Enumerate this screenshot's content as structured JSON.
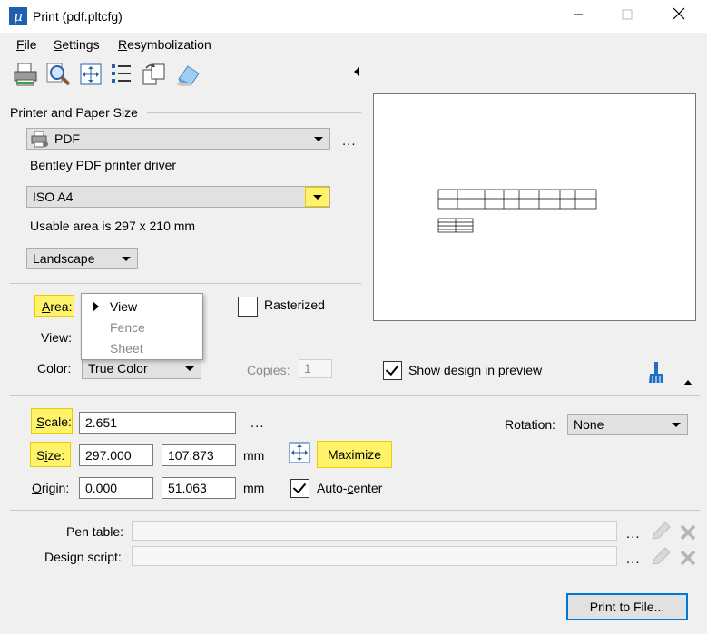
{
  "window": {
    "title": "Print  (pdf.pltcfg)",
    "app_icon_glyph": "µ"
  },
  "menu": {
    "file": {
      "pre": "",
      "u": "F",
      "post": "ile"
    },
    "settings": {
      "pre": "",
      "u": "S",
      "post": "ettings"
    },
    "resymbolization": {
      "pre": "",
      "u": "R",
      "post": "esymbolization"
    }
  },
  "printer": {
    "section_label": "Printer and Paper Size",
    "printer_name": "PDF",
    "driver": "Bentley PDF printer driver",
    "paper_size": "ISO A4",
    "usable_area": "Usable area is 297 x 210 mm",
    "orientation": "Landscape",
    "more": "..."
  },
  "area": {
    "label_pre": "",
    "label_u": "A",
    "label_post": "rea:",
    "menu_items": [
      {
        "label": "View",
        "selected": true,
        "enabled": true
      },
      {
        "label": "Fence",
        "selected": false,
        "enabled": false
      },
      {
        "label": "Sheet",
        "selected": false,
        "enabled": false
      }
    ]
  },
  "rasterized": {
    "label": "Rasterized",
    "checked": false
  },
  "view": {
    "label": "View:"
  },
  "color": {
    "label": "Color:",
    "value": "True Color"
  },
  "copies": {
    "label_pre": "Copi",
    "label_u": "e",
    "label_post": "s:",
    "value": "1"
  },
  "show_preview": {
    "pre": "Show ",
    "u": "d",
    "post": "esign in preview",
    "checked": true
  },
  "scale": {
    "label_pre": "",
    "label_u": "S",
    "label_post": "cale:",
    "value": "2.651",
    "more": "..."
  },
  "rotation": {
    "label": "Rotation:",
    "value": "None"
  },
  "size": {
    "label_pre": "S",
    "label_u": "i",
    "label_post": "ze:",
    "width": "297.000",
    "height": "107.873",
    "unit": "mm"
  },
  "maximize": {
    "label": "Maximize"
  },
  "origin": {
    "label_pre": "",
    "label_u": "O",
    "label_post": "rigin:",
    "x": "0.000",
    "y": "51.063",
    "unit": "mm"
  },
  "autocenter": {
    "pre": "Auto-",
    "u": "c",
    "post": "enter",
    "checked": true
  },
  "pen_table": {
    "label": "Pen table:",
    "value": "",
    "more": "..."
  },
  "design_script": {
    "label": "Design script:",
    "value": "",
    "more": "..."
  },
  "print_button": {
    "label": "Print to File..."
  },
  "colors": {
    "highlight": "#fff36a",
    "accent": "#0078d7",
    "icon_blue": "#1f5fb0"
  },
  "icons": [
    "printer-icon",
    "preview-icon",
    "fit-icon",
    "list-icon",
    "batch-icon",
    "eraser-icon",
    "brush-icon",
    "pencil-icon",
    "delete-icon"
  ]
}
